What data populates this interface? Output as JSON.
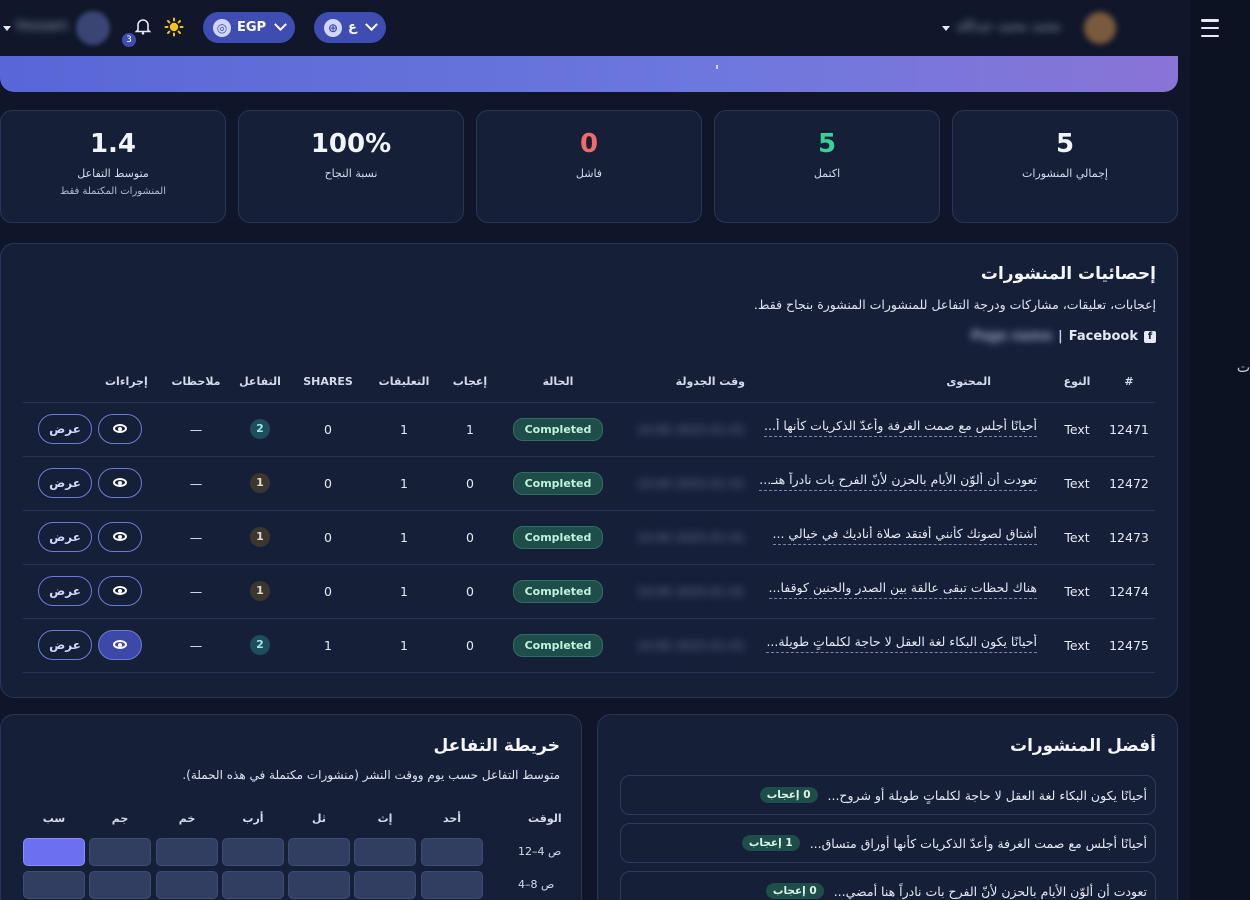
{
  "topbar": {
    "user_name_blurred": "Hossam",
    "notifications_count": "3",
    "currency_label": "EGP",
    "language_label": "ع",
    "right_user_blurred": "محمد محمد عبدالله"
  },
  "stats": [
    {
      "value": "1.4",
      "label": "متوسط التفاعل",
      "sub": "المنشورات المكتملة فقط",
      "color": "#f2f4fb"
    },
    {
      "value": "100%",
      "label": "نسبة النجاح",
      "sub": "",
      "color": "#f2f4fb"
    },
    {
      "value": "0",
      "label": "فاشل",
      "sub": "",
      "color": "#f26a6a"
    },
    {
      "value": "5",
      "label": "اكتمل",
      "sub": "",
      "color": "#34d399"
    },
    {
      "value": "5",
      "label": "إجمالي المنشورات",
      "sub": "",
      "color": "#f2f4fb"
    }
  ],
  "posts_stats": {
    "title": "إحصائيات المنشورات",
    "description": "إعجابات، تعليقات، مشاركات ودرجة التفاعل للمنشورات المنشورة بنجاح فقط.",
    "platform": "Facebook",
    "page_blurred": "Page name",
    "columns": {
      "id": "#",
      "type": "النوع",
      "content": "المحتوى",
      "scheduled": "وقت الجدولة",
      "status": "الحالة",
      "likes": "إعجاب",
      "comments": "التعليقات",
      "shares": "SHARES",
      "engagement": "التفاعل",
      "notes": "ملاحظات",
      "actions": "إجراءات"
    },
    "view_label": "عرض",
    "rows": [
      {
        "id": "12471",
        "type": "Text",
        "content": "أحيانًا أجلس مع صمت الغرفة وأعدّ الذكريات كأنها أ...",
        "scheduled": "2025-01-01 10:00",
        "status": "Completed",
        "likes": "1",
        "comments": "1",
        "shares": "0",
        "engagement": "2",
        "notes": "—"
      },
      {
        "id": "12472",
        "type": "Text",
        "content": "تعودت أن ألوّن الأيام بالحزن لأنّ الفرح بات نادراً هنـ...",
        "scheduled": "2025-01-01 10:00",
        "status": "Completed",
        "likes": "0",
        "comments": "1",
        "shares": "0",
        "engagement": "1",
        "notes": "—"
      },
      {
        "id": "12473",
        "type": "Text",
        "content": "أشتاق لصوتك كأنني أفتقد صلاة أناديك في خيالي ...",
        "scheduled": "2025-01-01 10:00",
        "status": "Completed",
        "likes": "0",
        "comments": "1",
        "shares": "0",
        "engagement": "1",
        "notes": "—"
      },
      {
        "id": "12474",
        "type": "Text",
        "content": "هناك لحظات تبقى عالقة بين الصدر والحنين كوقفا...",
        "scheduled": "2025-01-01 10:00",
        "status": "Completed",
        "likes": "0",
        "comments": "1",
        "shares": "0",
        "engagement": "1",
        "notes": "—"
      },
      {
        "id": "12475",
        "type": "Text",
        "content": "أحيانًا يكون البكاء لغة العقل لا حاجة لكلماتٍ طويلة...",
        "scheduled": "2025-01-01 10:00",
        "status": "Completed",
        "likes": "0",
        "comments": "1",
        "shares": "1",
        "engagement": "2",
        "notes": "—"
      }
    ]
  },
  "top_posts": {
    "title": "أفضل المنشورات",
    "items": [
      {
        "text": "أحيانًا يكون البكاء لغة العقل لا حاجة لكلماتٍ طويلة أو شروح...",
        "badge": "0 إعجاب"
      },
      {
        "text": "أحيانًا أجلس مع صمت الغرفة وأعدّ الذكريات كأنها أوراق متساق...",
        "badge": "1 إعجاب"
      },
      {
        "text": "تعودت أن ألوّن الأيام بالحزن لأنّ الفرح بات نادراً هنا أمضي...",
        "badge": "0 إعجاب"
      }
    ]
  },
  "heatmap": {
    "title": "خريطة التفاعل",
    "description": "متوسط التفاعل حسب يوم ووقت النشر (منشورات مكتملة في هذه الحملة).",
    "time_label": "الوقت",
    "days": [
      "أحد",
      "إث",
      "ثل",
      "أرب",
      "خم",
      "جم",
      "سب"
    ],
    "rows": [
      {
        "label": "12–4 ص",
        "values": [
          0,
          0,
          0,
          0,
          0,
          0,
          1
        ]
      },
      {
        "label": "4–8 ص",
        "values": [
          0,
          0,
          0,
          0,
          0,
          0,
          0
        ]
      }
    ],
    "low_color": "#313d61",
    "high_color": "#6c6ff0"
  }
}
